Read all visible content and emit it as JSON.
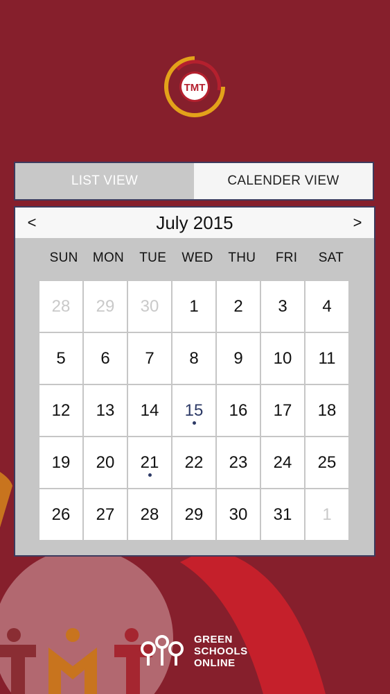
{
  "tabs": {
    "list_view": "LIST VIEW",
    "calendar_view": "CALENDER VIEW"
  },
  "calendar": {
    "title": "July 2015",
    "prev": "<",
    "next": ">",
    "weekdays": [
      "SUN",
      "MON",
      "TUE",
      "WED",
      "THU",
      "FRI",
      "SAT"
    ],
    "days": [
      {
        "label": "28",
        "state": "muted"
      },
      {
        "label": "29",
        "state": "muted"
      },
      {
        "label": "30",
        "state": "muted"
      },
      {
        "label": "1"
      },
      {
        "label": "2"
      },
      {
        "label": "3"
      },
      {
        "label": "4"
      },
      {
        "label": "5"
      },
      {
        "label": "6"
      },
      {
        "label": "7"
      },
      {
        "label": "8"
      },
      {
        "label": "9"
      },
      {
        "label": "10"
      },
      {
        "label": "11"
      },
      {
        "label": "12"
      },
      {
        "label": "13"
      },
      {
        "label": "14"
      },
      {
        "label": "15",
        "state": "today",
        "event": true
      },
      {
        "label": "16"
      },
      {
        "label": "17"
      },
      {
        "label": "18"
      },
      {
        "label": "19"
      },
      {
        "label": "20"
      },
      {
        "label": "21",
        "event": true
      },
      {
        "label": "22"
      },
      {
        "label": "23"
      },
      {
        "label": "24"
      },
      {
        "label": "25"
      },
      {
        "label": "26"
      },
      {
        "label": "27"
      },
      {
        "label": "28"
      },
      {
        "label": "29"
      },
      {
        "label": "30"
      },
      {
        "label": "31"
      },
      {
        "label": "1",
        "state": "muted"
      }
    ]
  },
  "branding": {
    "logo_text": "TMT",
    "footer_lines": [
      "GREEN",
      "SCHOOLS",
      "ONLINE"
    ]
  },
  "colors": {
    "background": "#861f2c",
    "accent_blue": "#2d3a66",
    "logo_yellow": "#e3a21a",
    "logo_red": "#b4202e"
  }
}
